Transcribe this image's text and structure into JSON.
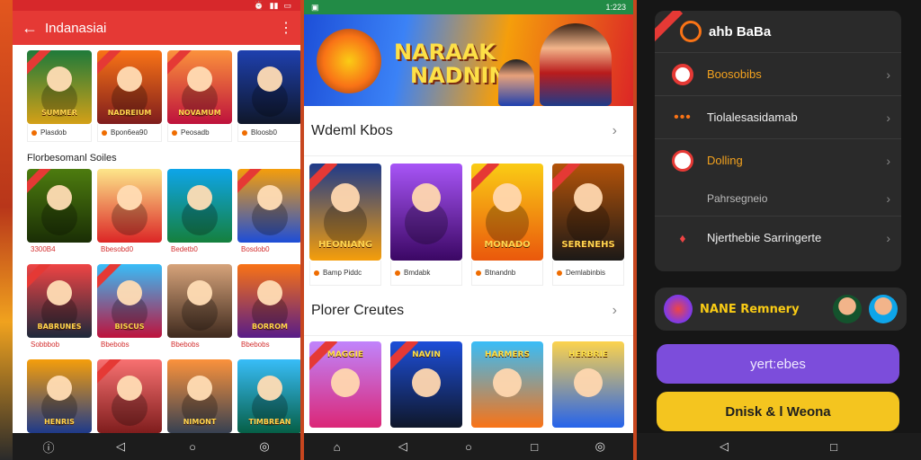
{
  "panel1": {
    "app_title": "Indanasiai",
    "featured": [
      {
        "caption": "SUMMER",
        "label": "Plasdob",
        "bg": "linear-gradient(180deg,#1e7a3a,#d4a017)"
      },
      {
        "caption": "NADREIUM",
        "label": "Bpon6ea90",
        "bg": "linear-gradient(180deg,#f97316,#7f1d1d)"
      },
      {
        "caption": "NOVAMUM",
        "label": "Peosadb",
        "bg": "linear-gradient(180deg,#fb923c,#be123c)"
      },
      {
        "caption": "",
        "label": "Bloosb0",
        "bg": "linear-gradient(180deg,#1e40af,#0f172a)"
      }
    ],
    "section_title": "Florbesomanl Soiles",
    "rows": [
      [
        {
          "caption": "",
          "label": "3300B4",
          "bg": "linear-gradient(180deg,#4d7c0f,#1a2e05)"
        },
        {
          "caption": "",
          "label": "Bbesobd0",
          "bg": "linear-gradient(180deg,#fde68a,#dc2626)"
        },
        {
          "caption": "",
          "label": "Bedetb0",
          "bg": "linear-gradient(180deg,#0ea5e9,#15803d)"
        },
        {
          "caption": "",
          "label": "Bosdob0",
          "bg": "linear-gradient(180deg,#f59e0b,#1d4ed8)"
        }
      ],
      [
        {
          "caption": "BABRUNES",
          "label": "Sobbbob",
          "bg": "linear-gradient(180deg,#ef4444,#1e293b)"
        },
        {
          "caption": "BISCUS",
          "label": "Bbebobs",
          "bg": "linear-gradient(180deg,#38bdf8,#be123c)"
        },
        {
          "caption": "",
          "label": "Bbebobs",
          "bg": "linear-gradient(180deg,#d6a37a,#3f2a1e)"
        },
        {
          "caption": "BORROM",
          "label": "Bbebobs",
          "bg": "linear-gradient(180deg,#f97316,#581c87)"
        }
      ],
      [
        {
          "caption": "HENRIS",
          "label": "",
          "bg": "linear-gradient(180deg,#f59e0b,#1e3a8a)"
        },
        {
          "caption": "",
          "label": "",
          "bg": "linear-gradient(180deg,#f87171,#7f1d1d)"
        },
        {
          "caption": "NIMONT",
          "label": "",
          "bg": "linear-gradient(180deg,#fb923c,#374151)"
        },
        {
          "caption": "TIMBREAN",
          "label": "",
          "bg": "linear-gradient(180deg,#38bdf8,#065f46)"
        }
      ]
    ]
  },
  "panel2": {
    "status_time": "1:223",
    "banner_title_1": "NARAAK",
    "banner_title_2": "NADNIN",
    "section1_title": "Wdeml Kbos",
    "section1_items": [
      {
        "caption": "HEONIANG",
        "label": "Bamp Piddc",
        "bg": "linear-gradient(180deg,#1e3a8a,#f59e0b)"
      },
      {
        "caption": "",
        "label": "Bmdabk",
        "bg": "linear-gradient(180deg,#a855f7,#3b0764)"
      },
      {
        "caption": "MONADO",
        "label": "Btnandnb",
        "bg": "linear-gradient(180deg,#facc15,#ea580c)"
      },
      {
        "caption": "SERENEHS",
        "label": "Demlabinbis",
        "bg": "linear-gradient(180deg,#b45309,#1c1917)"
      }
    ],
    "section2_title": "Plorer Creutes",
    "section2_items": [
      {
        "caption": "MAGGIE",
        "bg": "linear-gradient(180deg,#c084fc,#db2777)"
      },
      {
        "caption": "NAVIN",
        "bg": "linear-gradient(180deg,#1d4ed8,#0f172a)"
      },
      {
        "caption": "HARMERS",
        "bg": "linear-gradient(180deg,#38bdf8,#f97316)"
      },
      {
        "caption": "HERBRIE",
        "bg": "linear-gradient(180deg,#fcd34d,#2563eb)"
      }
    ]
  },
  "panel3": {
    "header_title": "ahb BaBa",
    "items": [
      {
        "label": "Boosobibs",
        "sub": ""
      },
      {
        "label": "Tiolalesasidamab",
        "sub": ""
      },
      {
        "label": "Dolling",
        "sub": "Pahrsegneio"
      },
      {
        "label": "Njerthebie Sarringerte",
        "sub": ""
      }
    ],
    "promo_text": "NANE Remnery",
    "btn_primary": "yert:ebes",
    "btn_secondary": "Dnisk & l Weona"
  },
  "colors": {
    "red_appbar": "#e53935",
    "green_status": "#228b46",
    "purple_button": "#7c4ddb",
    "yellow_button": "#f4c51f"
  }
}
